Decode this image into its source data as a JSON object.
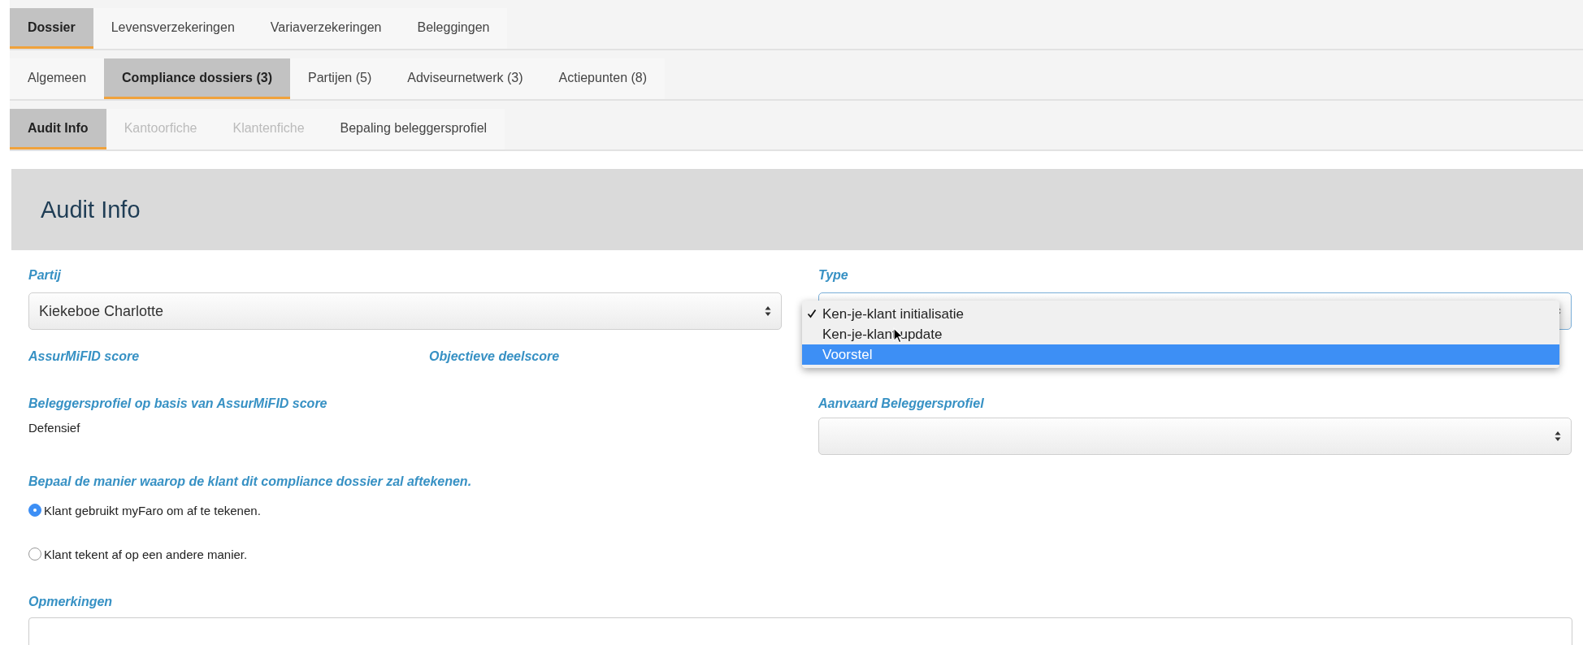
{
  "tabs_primary": [
    {
      "label": "Dossier",
      "selected": true
    },
    {
      "label": "Levensverzekeringen",
      "selected": false
    },
    {
      "label": "Variaverzekeringen",
      "selected": false
    },
    {
      "label": "Beleggingen",
      "selected": false
    }
  ],
  "tabs_secondary": [
    {
      "label": "Algemeen",
      "selected": false
    },
    {
      "label": "Compliance dossiers (3)",
      "selected": true
    },
    {
      "label": "Partijen (5)",
      "selected": false
    },
    {
      "label": "Adviseurnetwerk (3)",
      "selected": false
    },
    {
      "label": "Actiepunten (8)",
      "selected": false
    }
  ],
  "tabs_tertiary": [
    {
      "label": "Audit Info",
      "selected": true,
      "disabled": false
    },
    {
      "label": "Kantoorfiche",
      "selected": false,
      "disabled": true
    },
    {
      "label": "Klantenfiche",
      "selected": false,
      "disabled": true
    },
    {
      "label": "Bepaling beleggersprofiel",
      "selected": false,
      "disabled": false
    }
  ],
  "panel": {
    "title": "Audit Info"
  },
  "form": {
    "partij": {
      "label": "Partij",
      "value": "Kiekeboe Charlotte"
    },
    "type": {
      "label": "Type",
      "options": [
        {
          "label": "Ken-je-klant initialisatie",
          "checked": true,
          "selected": false
        },
        {
          "label": "Ken-je-klant update",
          "checked": false,
          "selected": false
        },
        {
          "label": "Voorstel",
          "checked": false,
          "selected": true
        }
      ]
    },
    "assurmifid_score": {
      "label": "AssurMiFID score"
    },
    "objectieve_deelscore": {
      "label": "Objectieve deelscore"
    },
    "beleggersprofiel": {
      "label": "Beleggersprofiel op basis van AssurMiFID score",
      "value": "Defensief"
    },
    "aanvaard_beleggersprofiel": {
      "label": "Aanvaard Beleggersprofiel"
    },
    "aftekenen": {
      "label": "Bepaal de manier waarop de klant dit compliance dossier zal aftekenen.",
      "options": [
        {
          "label": "Klant gebruikt myFaro om af te tekenen.",
          "selected": true
        },
        {
          "label": "Klant tekent af op een andere manier.",
          "selected": false
        }
      ]
    },
    "opmerkingen": {
      "label": "Opmerkingen"
    }
  }
}
